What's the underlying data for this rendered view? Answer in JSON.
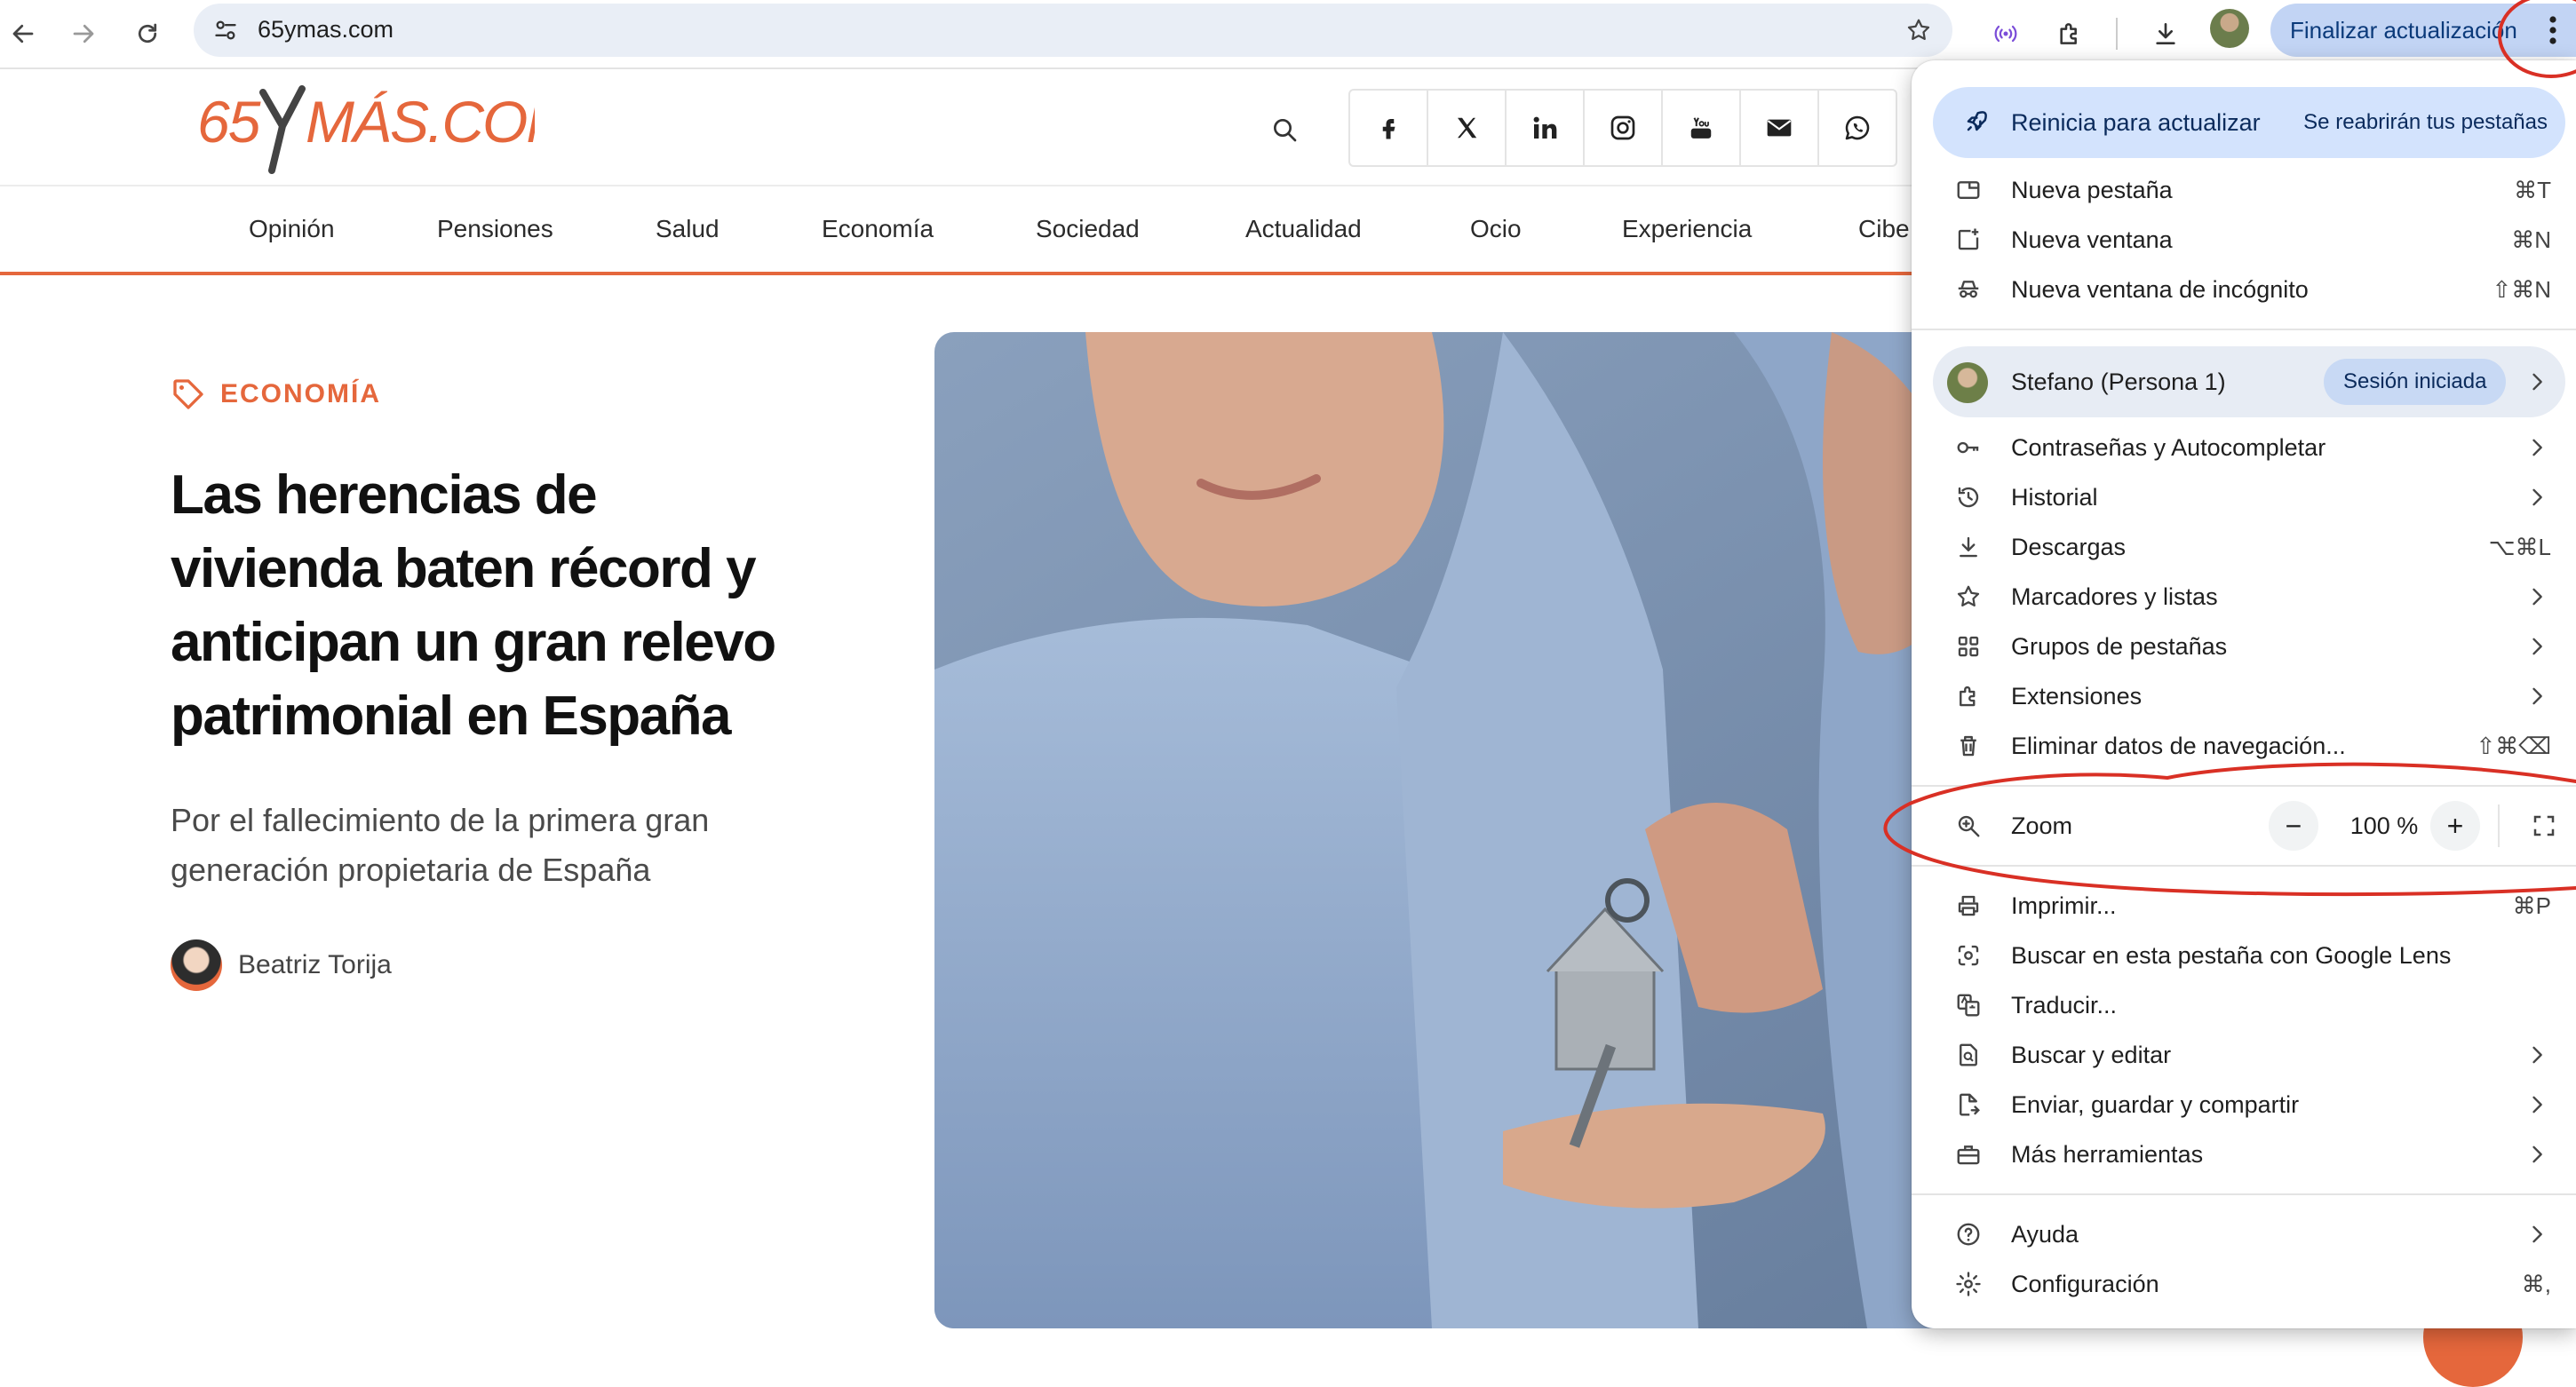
{
  "browser": {
    "url": "65ymas.com",
    "update_button_label": "Finalizar actualización",
    "icons": {
      "back": "arrow-left-icon",
      "forward": "arrow-right-icon",
      "reload": "reload-icon",
      "site_info": "tune-icon",
      "bookmark": "star-icon",
      "cast": "broadcast-icon",
      "extensions": "puzzle-icon",
      "downloads": "download-icon",
      "menu": "kebab-icon"
    }
  },
  "site": {
    "brand_color": "#e5673c",
    "nav": [
      "Opinión",
      "Pensiones",
      "Salud",
      "Economía",
      "Sociedad",
      "Actualidad",
      "Ocio",
      "Experiencia",
      "Cibe"
    ],
    "social_icons": [
      "facebook-icon",
      "x-icon",
      "linkedin-icon",
      "instagram-icon",
      "youtube-icon",
      "mail-icon",
      "whatsapp-icon"
    ]
  },
  "article": {
    "category": "ECONOMÍA",
    "headline_lines": [
      "Las herencias de",
      "vivienda baten récord y",
      "anticipan un gran relevo",
      "patrimonial en España"
    ],
    "subhead_lines": [
      "Por el fallecimiento de la primera gran",
      "generación propietaria de España"
    ],
    "author": "Beatriz Torija"
  },
  "menu": {
    "relaunch": {
      "label": "Reinicia para actualizar",
      "note": "Se reabrirán tus pestañas"
    },
    "group1": [
      {
        "label": "Nueva pestaña",
        "shortcut": "⌘T"
      },
      {
        "label": "Nueva ventana",
        "shortcut": "⌘N"
      },
      {
        "label": "Nueva ventana de incógnito",
        "shortcut": "⇧⌘N"
      }
    ],
    "profile": {
      "name": "Stefano (Persona 1)",
      "status": "Sesión iniciada"
    },
    "group2": [
      {
        "label": "Contraseñas y Autocompletar",
        "shortcut": ""
      },
      {
        "label": "Historial",
        "shortcut": ""
      },
      {
        "label": "Descargas",
        "shortcut": "⌥⌘L"
      },
      {
        "label": "Marcadores y listas",
        "shortcut": ""
      },
      {
        "label": "Grupos de pestañas",
        "shortcut": ""
      },
      {
        "label": "Extensiones",
        "shortcut": ""
      },
      {
        "label": "Eliminar datos de navegación...",
        "shortcut": "⇧⌘⌫"
      }
    ],
    "zoom": {
      "label": "Zoom",
      "value": "100 %",
      "minus": "−",
      "plus": "+"
    },
    "group3": [
      {
        "label": "Imprimir...",
        "shortcut": "⌘P"
      },
      {
        "label": "Buscar en esta pestaña con Google Lens",
        "shortcut": ""
      },
      {
        "label": "Traducir...",
        "shortcut": ""
      },
      {
        "label": "Buscar y editar",
        "shortcut": ""
      },
      {
        "label": "Enviar, guardar y compartir",
        "shortcut": ""
      },
      {
        "label": "Más herramientas",
        "shortcut": ""
      }
    ],
    "group4": [
      {
        "label": "Ayuda",
        "shortcut": ""
      },
      {
        "label": "Configuración",
        "shortcut": "⌘,"
      }
    ]
  },
  "annotation_color": "#d93025"
}
